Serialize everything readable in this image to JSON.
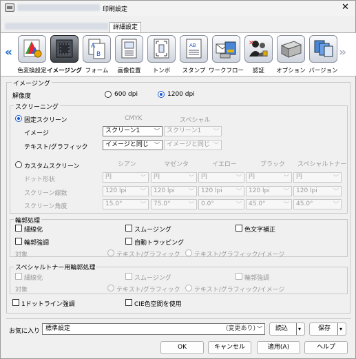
{
  "window": {
    "title_blurred": "KONICA MINOLTA C14610Series PS",
    "title": "印刷設定",
    "close_label": "✕"
  },
  "tabs": {
    "blurred_tab": "KONICA MINOLTA C14610Series PS",
    "detail_tab": "詳細設定"
  },
  "iconbar": {
    "left_arrow": "«",
    "right_arrow": "»",
    "items": [
      {
        "label": "色変換設定",
        "icon": "color-conversion-icon"
      },
      {
        "label": "イメージング",
        "icon": "imaging-icon"
      },
      {
        "label": "フォーム",
        "icon": "form-icon"
      },
      {
        "label": "画像位置",
        "icon": "image-position-icon"
      },
      {
        "label": "トンボ",
        "icon": "crop-mark-icon"
      },
      {
        "label": "スタンプ",
        "icon": "stamp-icon"
      },
      {
        "label": "ワークフロー",
        "icon": "workflow-icon"
      },
      {
        "label": "認証",
        "icon": "authentication-icon"
      },
      {
        "label": "オプション",
        "icon": "option-icon"
      },
      {
        "label": "バージョン",
        "icon": "version-icon"
      }
    ]
  },
  "imaging": {
    "section_title": "イメージング",
    "resolution_label": "解像度",
    "res_600": "600 dpi",
    "res_1200": "1200 dpi",
    "screening": {
      "title": "スクリーニング",
      "fixed_label": "固定スクリーン",
      "col_cmyk": "CMYK",
      "col_special": "スペシャル",
      "image_label": "イメージ",
      "image_cmyk": "スクリーン1",
      "image_special": "スクリーン1",
      "text_label": "テキスト/グラフィック",
      "text_cmyk": "イメージと同じ",
      "text_special": "イメージと同じ",
      "custom_label": "カスタムスクリーン",
      "custom_cols": [
        "シアン",
        "マゼンタ",
        "イエロー",
        "ブラック",
        "スペシャルトナー"
      ],
      "rows": [
        {
          "label": "ドット形状",
          "values": [
            "円",
            "円",
            "円",
            "円",
            "円"
          ]
        },
        {
          "label": "スクリーン線数",
          "values": [
            "120 lpi",
            "120 lpi",
            "120 lpi",
            "120 lpi",
            "120 lpi"
          ]
        },
        {
          "label": "スクリーン角度",
          "values": [
            "15.0°",
            "75.0°",
            "0.0°",
            "45.0°",
            "45.0°"
          ]
        }
      ]
    },
    "outline": {
      "title": "輪郭処理",
      "thin": "細線化",
      "smoothing": "スムージング",
      "color_text": "色文字補正",
      "emphasis": "輪郭強調",
      "trapping": "自動トラッピング",
      "target_label": "対象",
      "target_text": "テキスト/グラフィック",
      "target_all": "テキスト/グラフィック/イメージ"
    },
    "special_outline": {
      "title": "スペシャルトナー用輪郭処理",
      "thin": "細線化",
      "smoothing": "スムージング",
      "emphasis": "輪郭強調",
      "target_label": "対象",
      "target_text": "テキスト/グラフィック",
      "target_all": "テキスト/グラフィック/イメージ"
    },
    "one_dot_line": "1ドットライン強調",
    "cie": "CIE色空間を使用"
  },
  "favorites": {
    "label": "お気に入り",
    "value": "標準設定",
    "status": "(変更あり)",
    "load": "読込",
    "save": "保存"
  },
  "buttons": {
    "ok": "OK",
    "cancel": "キャンセル",
    "apply": "適用(A)",
    "help": "ヘルプ"
  }
}
